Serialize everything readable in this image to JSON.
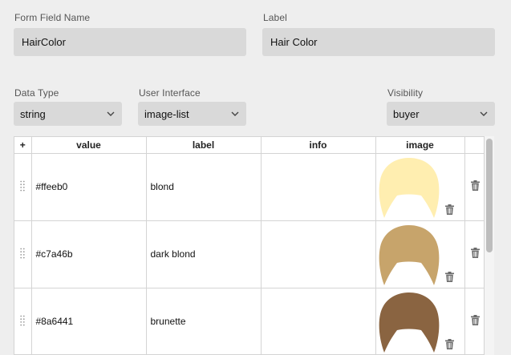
{
  "form": {
    "field_name_label": "Form Field Name",
    "field_name_value": "HairColor",
    "label_label": "Label",
    "label_value": "Hair Color",
    "data_type_label": "Data Type",
    "data_type_value": "string",
    "ui_label": "User Interface",
    "ui_value": "image-list",
    "visibility_label": "Visibility",
    "visibility_value": "buyer"
  },
  "table": {
    "columns": {
      "add": "+",
      "value": "value",
      "label": "label",
      "info": "info",
      "image": "image"
    },
    "rows": [
      {
        "value": "#ffeeb0",
        "label": "blond",
        "info": "",
        "hair_color": "#ffeeb0"
      },
      {
        "value": "#c7a46b",
        "label": "dark blond",
        "info": "",
        "hair_color": "#c7a46b"
      },
      {
        "value": "#8a6441",
        "label": "brunette",
        "info": "",
        "hair_color": "#8a6441"
      }
    ]
  },
  "icons": {
    "drag": "drag-handle-icon",
    "trash": "trash-icon",
    "chevron": "chevron-down-icon"
  }
}
